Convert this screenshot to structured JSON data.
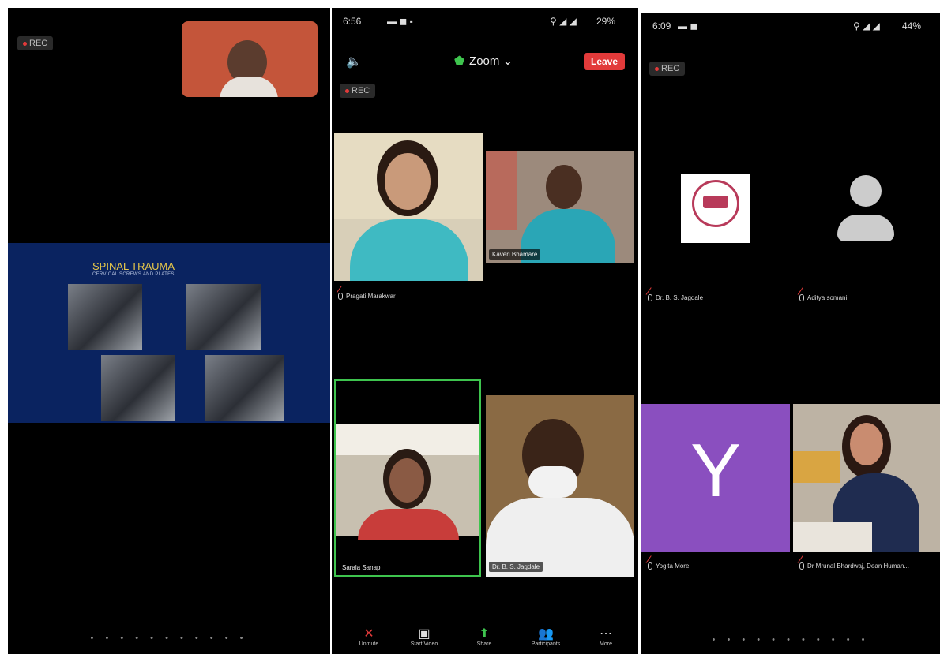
{
  "panel1": {
    "rec_label": "REC",
    "slide": {
      "title": "SPINAL TRAUMA",
      "subtitle": "CERVICAL SCREWS AND PLATES"
    },
    "pager": "• • • • • • • • • • •"
  },
  "panel2": {
    "status_time": "6:56",
    "battery": "29%",
    "app_title": "Zoom",
    "leave_label": "Leave",
    "rec_label": "REC",
    "participants": [
      {
        "name": "Pragati Marakwar"
      },
      {
        "name": "Kaveri Bhamare"
      },
      {
        "name": "Sarala Sanap"
      },
      {
        "name": "Dr. B. S. Jagdale"
      }
    ],
    "toolbar": [
      {
        "label": "Unmute",
        "icon": "mic-off-icon"
      },
      {
        "label": "Start Video",
        "icon": "video-off-icon"
      },
      {
        "label": "Share",
        "icon": "share-icon"
      },
      {
        "label": "Participants",
        "icon": "participants-icon"
      },
      {
        "label": "More",
        "icon": "more-icon"
      }
    ]
  },
  "panel3": {
    "status_time": "6:09",
    "battery": "44%",
    "rec_label": "REC",
    "participants": [
      {
        "name": "Dr. B. S. Jagdale"
      },
      {
        "name": "Aditya somani"
      },
      {
        "name": "Yogita More",
        "initial": "Y"
      },
      {
        "name": "Dr Mrunal Bhardwaj, Dean Human..."
      }
    ],
    "pager": "• • • • • • • • • • •"
  },
  "colors": {
    "accent_purple": "#8a4fbf",
    "leave_red": "#e23a3a",
    "active_speaker_green": "#3ec44e"
  }
}
